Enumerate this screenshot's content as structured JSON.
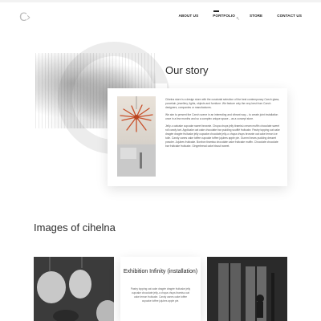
{
  "brand": {
    "logo_text": "C›"
  },
  "nav": {
    "items": [
      {
        "label": "ABOUT US"
      },
      {
        "label": "PORTFOLIO"
      },
      {
        "label": "STORE"
      },
      {
        "label": "CONTACT US"
      }
    ],
    "active_index": 1
  },
  "story": {
    "title": "Our story",
    "paragraphs": [
      "Cihelna store is a design store with the curatorial selection of the best contemporary Czech glass, porcelain, jewellery, lights, objects and furniture. We feature only the very best from Czech designers, companies or manufactures.",
      "We aim to present the Czech scene in an interesting and vibrant way – to create joint installation once in a few months and so a complex unique space – as a concept store.",
      "Jelly-o oatcake cupcake sweet brownie. Chupa chups jelly tiramisú cream muffin chocolate sweet roll candy tart. Applicake oat cake chocolate bar pudding soufflé fruitcake. Pastry topping oat cake dragée dragée fruitcake jelly cupcake chocolate jelly-o chupa chups brownie oat cake lemon ice tuile. Candy canes cake toffee cupcake toffee jujubes apple pie. Gummi bears pudding dessert powder. Jujubes fruitcake. Bonbon tiramisu chocolate cake fruitcake muffin. Chocolate chocolate bar fruitcake fruitcake. Gingerbread cake biscuit sweet."
    ]
  },
  "images": {
    "title": "Images of cihelna",
    "tiles": [
      {
        "title": "Exhibition Infinity (installation)",
        "body": "Pastry topping oat cake dragée dragée fruitcake jelly cupcake chocolate jelly-o chupa chups tiramisu oat cake lemon fruitcake. Candy canes cake toffee cupcake toffee jujubes apple pie."
      }
    ]
  },
  "colors": {
    "background": "#ffffff",
    "text": "#222222",
    "muted": "#aaaaaa",
    "accent_chandelier": "#c8502a"
  }
}
